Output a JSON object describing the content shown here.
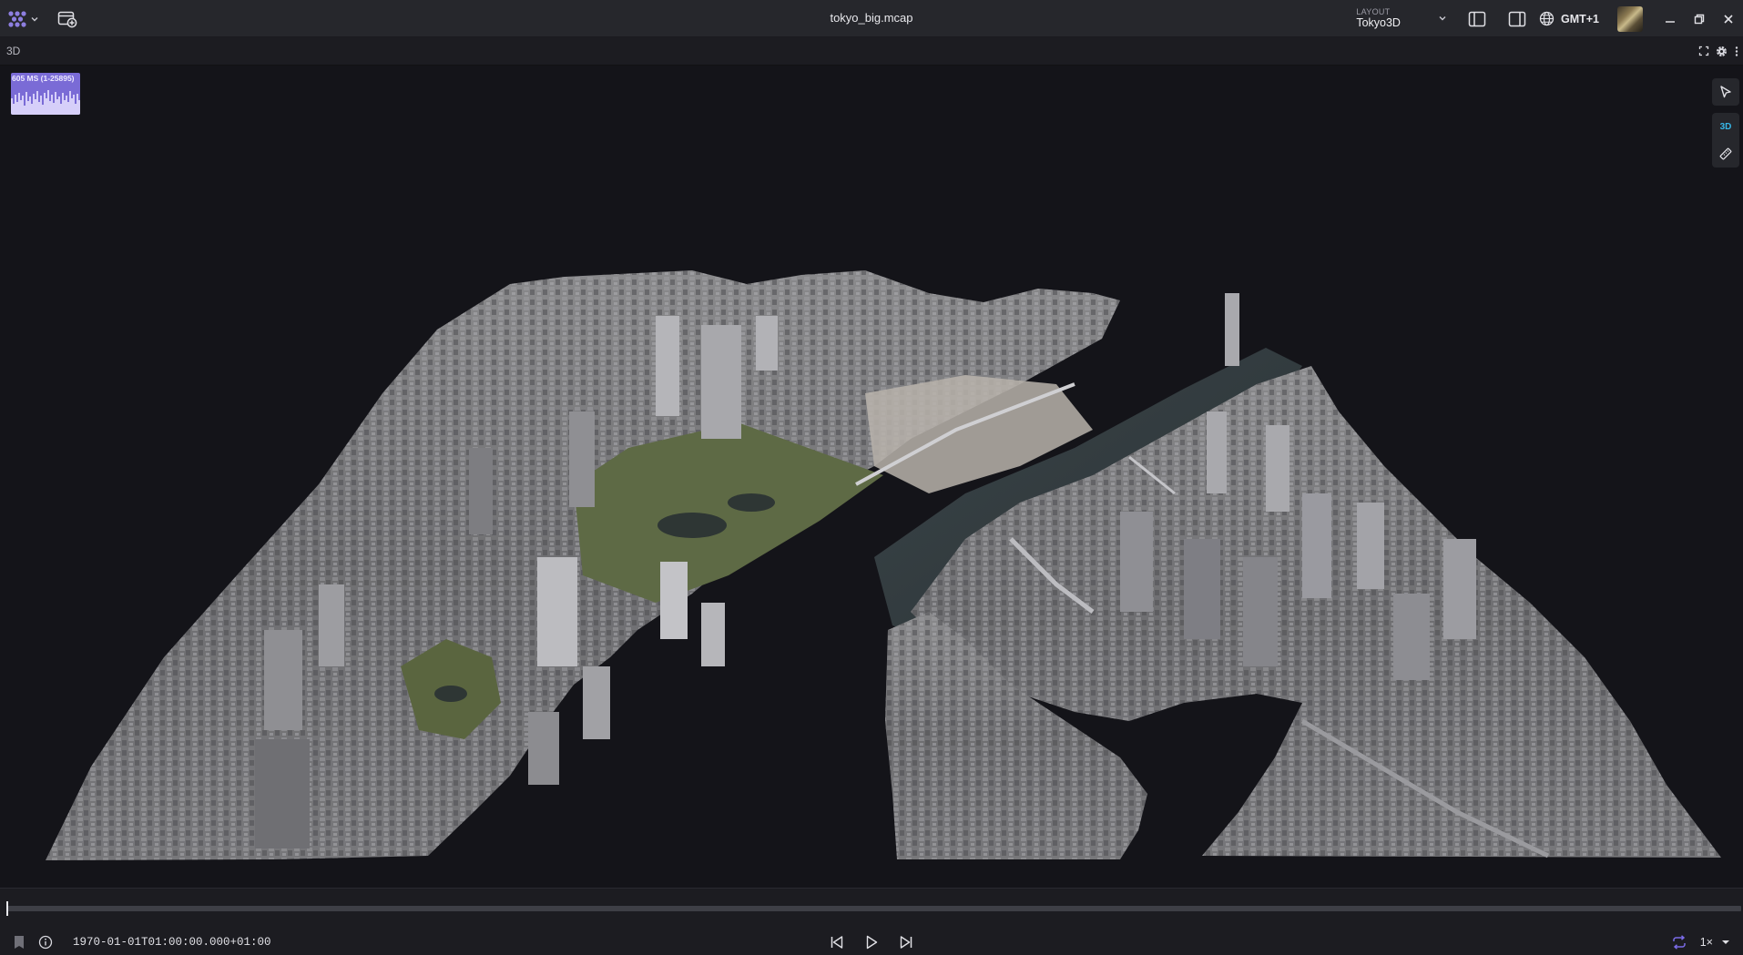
{
  "titlebar": {
    "file_name": "tokyo_big.mcap",
    "layout_caption": "LAYOUT",
    "layout_name": "Tokyo3D",
    "timezone": "GMT+1"
  },
  "panel": {
    "title": "3D"
  },
  "viewport": {
    "perf_label": "605 MS (1-25895)",
    "tools": [
      "select-icon",
      "3D",
      "ruler-icon"
    ],
    "scene": "3D city model of Tokyo waterfront"
  },
  "playback": {
    "timestamp": "1970-01-01T01:00:00.000+01:00",
    "speed": "1×",
    "progress_fraction": 0.0
  },
  "colors": {
    "accent": "#8d7ee0",
    "tool_3d": "#37b7e8",
    "loop": "#7b6be8",
    "background": "#141419"
  }
}
